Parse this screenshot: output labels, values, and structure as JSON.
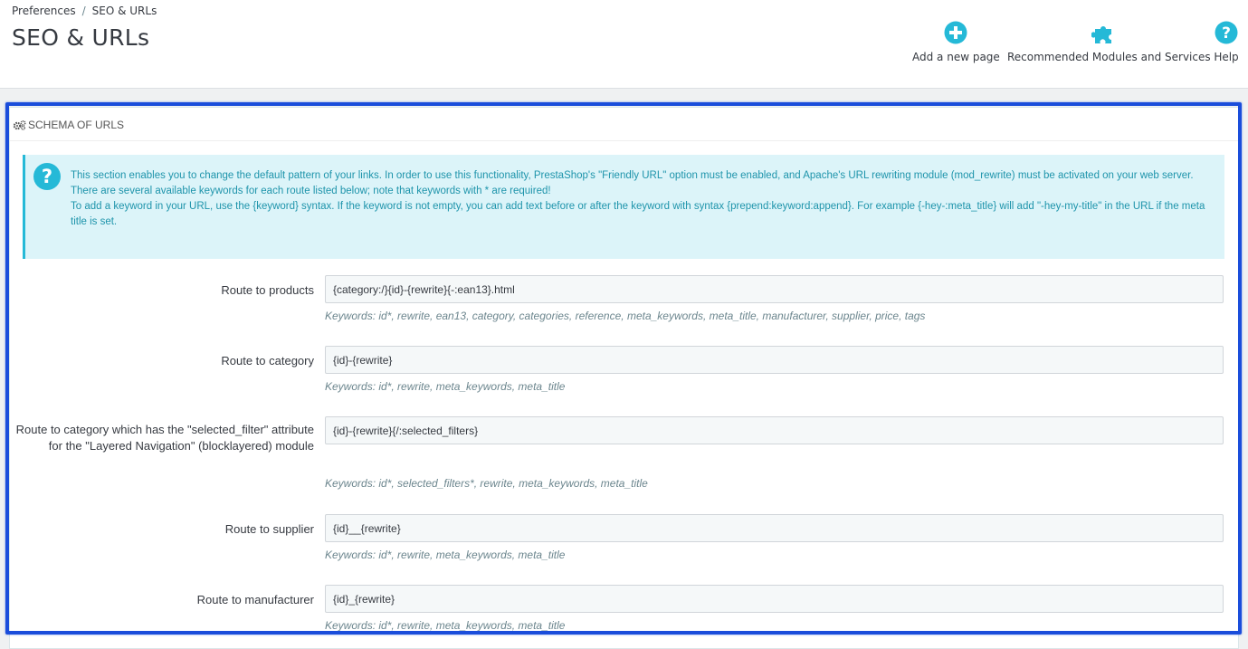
{
  "breadcrumb": {
    "items": [
      "Preferences",
      "SEO & URLs"
    ],
    "separator": "/"
  },
  "page_title": "SEO & URLs",
  "toolbar": {
    "add_page_label": "Add a new page",
    "add_page_icon": "plus-circle-icon",
    "modules_label": "Recommended Modules and Services",
    "modules_icon": "puzzle-icon",
    "help_label": "Help",
    "help_icon": "question-circle-icon"
  },
  "panel": {
    "heading_icon": "gears-icon",
    "heading": "SCHEMA OF URLS",
    "info_icon": "question-circle-icon",
    "info": {
      "line1": "This section enables you to change the default pattern of your links. In order to use this functionality, PrestaShop's \"Friendly URL\" option must be enabled, and Apache's URL rewriting module (mod_rewrite) must be activated on your web server.",
      "line2": "There are several available keywords for each route listed below; note that keywords with * are required!",
      "line3": "To add a keyword in your URL, use the {keyword} syntax. If the keyword is not empty, you can add text before or after the keyword with syntax {prepend:keyword:append}. For example {-hey-:meta_title} will add \"-hey-my-title\" in the URL if the meta title is set."
    },
    "routes": [
      {
        "label": "Route to products",
        "value": "{category:/}{id}-{rewrite}{-:ean13}.html",
        "keywords": "Keywords: id*, rewrite, ean13, category, categories, reference, meta_keywords, meta_title, manufacturer, supplier, price, tags"
      },
      {
        "label": "Route to category",
        "value": "{id}-{rewrite}",
        "keywords": "Keywords: id*, rewrite, meta_keywords, meta_title"
      },
      {
        "label": "Route to category which has the \"selected_filter\" attribute for the \"Layered Navigation\" (blocklayered) module",
        "value": "{id}-{rewrite}{/:selected_filters}",
        "keywords": "Keywords: id*, selected_filters*, rewrite, meta_keywords, meta_title"
      },
      {
        "label": "Route to supplier",
        "value": "{id}__{rewrite}",
        "keywords": "Keywords: id*, rewrite, meta_keywords, meta_title"
      },
      {
        "label": "Route to manufacturer",
        "value": "{id}_{rewrite}",
        "keywords": "Keywords: id*, rewrite, meta_keywords, meta_title"
      }
    ]
  },
  "colors": {
    "accent": "#25b9d7",
    "highlight_border": "#1a4ddb",
    "info_bg": "#dcf4f9",
    "info_text": "#1e94ab"
  }
}
